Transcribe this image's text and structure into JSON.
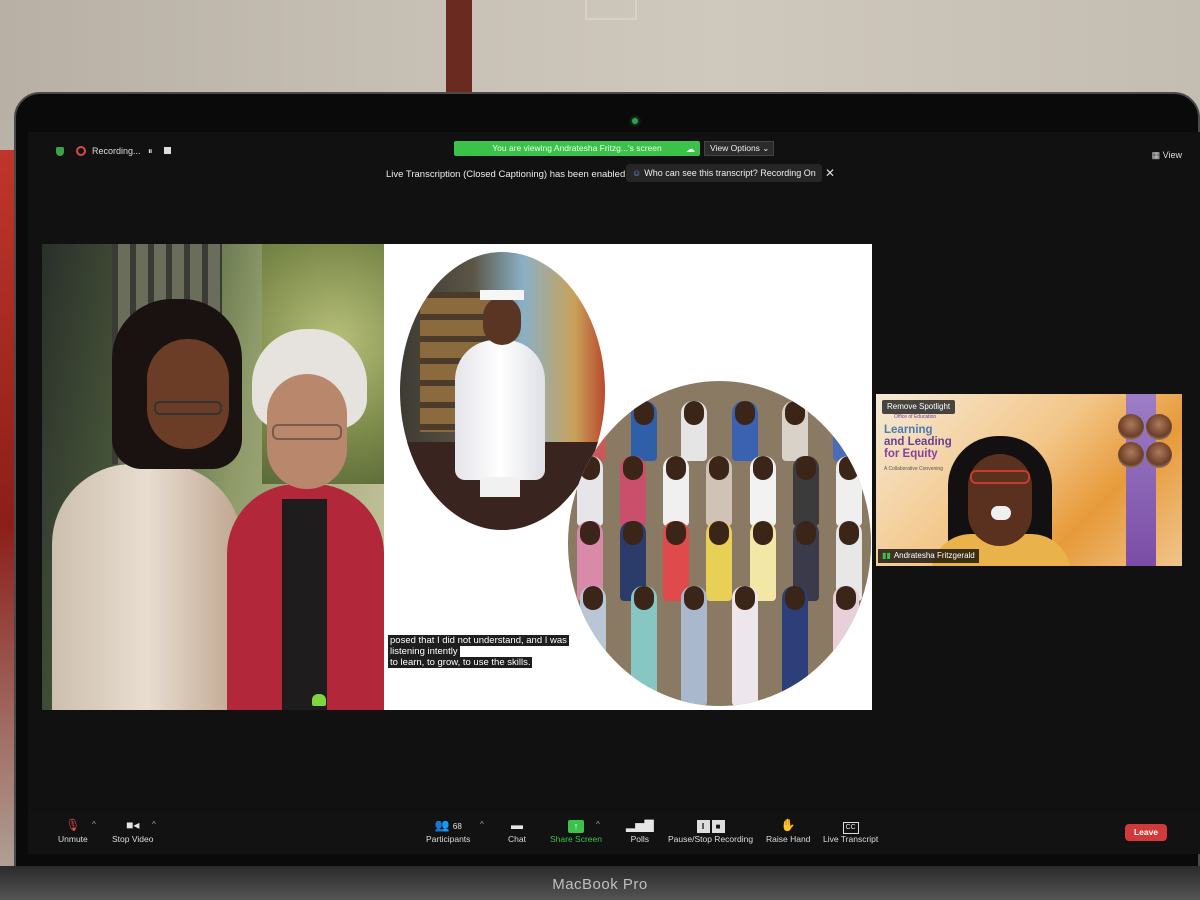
{
  "room": {
    "device_brand": "MacBook Pro"
  },
  "top_bar": {
    "recording_label": "Recording...",
    "pause_glyph": "⏸",
    "viewing_banner": "You are viewing Andratesha Fritzg...'s screen",
    "view_options_label": "View Options ⌄",
    "view_label": "View"
  },
  "notice": {
    "live_transcription": "Live Transcription (Closed Captioning) has been enabled",
    "who_can_see": "Who can see this transcript? Recording On",
    "close_glyph": "✕"
  },
  "shared_screen": {
    "captions": [
      "posed that I did not understand, and I was",
      "listening intently",
      "to learn, to grow, to use the skills."
    ]
  },
  "spotlight": {
    "remove_label": "Remove Spotlight",
    "office": "Office of Education",
    "title_lines": [
      "Learning",
      "and Leading",
      "for Equity"
    ],
    "subtitle": "A Collaborative Convening",
    "participant_name": "Andratesha Fritzgerald"
  },
  "toolbar": {
    "unmute": "Unmute",
    "stop_video": "Stop Video",
    "participants": "Participants",
    "participant_count": "68",
    "chat": "Chat",
    "share_screen": "Share Screen",
    "polls": "Polls",
    "pause_stop_recording": "Pause/Stop Recording",
    "raise_hand": "Raise Hand",
    "live_transcript": "Live Transcript",
    "cc_glyph": "CC",
    "leave": "Leave"
  },
  "icons": {
    "security": "shield-icon",
    "recording": "record-icon",
    "mic": "mic-muted-icon",
    "video": "video-camera-icon",
    "participants": "people-icon",
    "chat": "chat-bubble-icon",
    "share": "share-arrow-icon",
    "polls": "bar-chart-icon",
    "raise_hand": "hand-icon",
    "transcript": "cc-icon"
  },
  "colors": {
    "zoom_green": "#3cc14a",
    "leave_red": "#d13a3a",
    "spotlight_purple": "#6a3f8f"
  }
}
